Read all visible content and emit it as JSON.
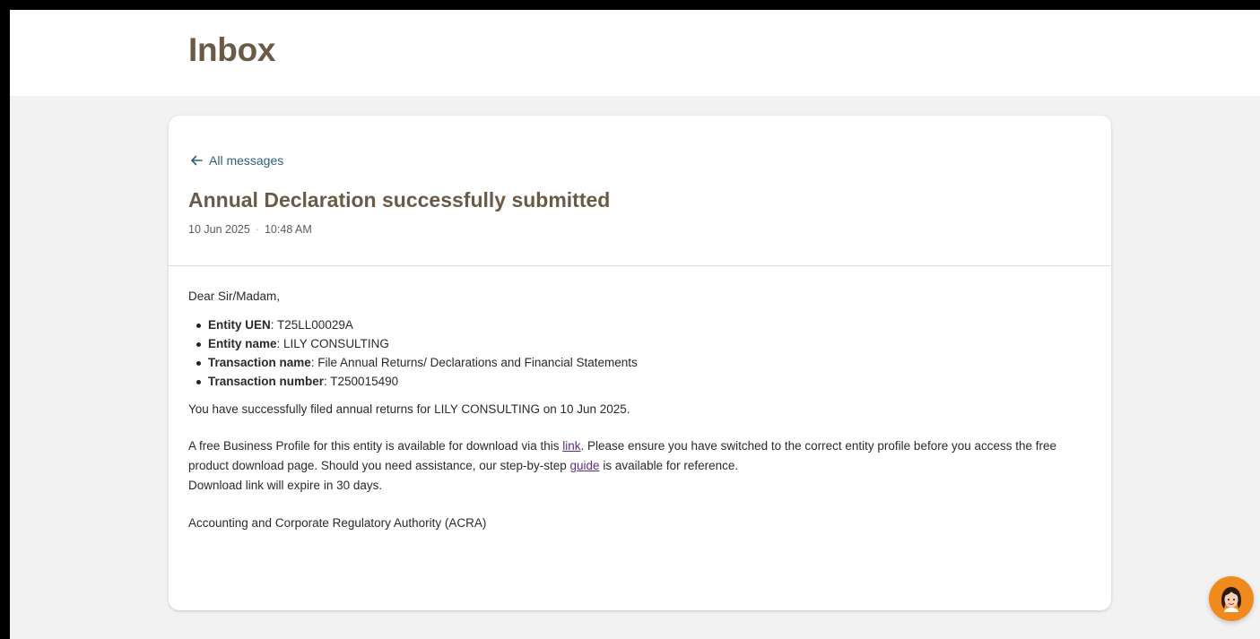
{
  "header": {
    "title": "Inbox"
  },
  "message": {
    "back_label": "All messages",
    "title": "Annual Declaration successfully submitted",
    "date": "10 Jun 2025",
    "time": "10:48 AM",
    "greeting": "Dear Sir/Madam,",
    "details": [
      {
        "label": "Entity UEN",
        "value": ": T25LL00029A"
      },
      {
        "label": "Entity name",
        "value": ": LILY CONSULTING"
      },
      {
        "label": "Transaction name",
        "value": ": File Annual Returns/ Declarations and Financial Statements"
      },
      {
        "label": "Transaction number",
        "value": ": T250015490"
      }
    ],
    "filed_text": "You have successfully filed annual returns for LILY CONSULTING on 10 Jun 2025.",
    "profile_text_1": "A free Business Profile for this entity is available for download via this ",
    "profile_link": "link",
    "profile_text_2": ". Please ensure you have switched to the correct entity profile before you access the free product download page. Should you need assistance, our step-by-step ",
    "guide_link": "guide",
    "profile_text_3": " is available for reference.",
    "expiry_text": "Download link will expire in 30 days.",
    "signature": "Accounting and Corporate Regulatory Authority (ACRA)"
  },
  "chat": {
    "icon": "assistant-avatar-icon",
    "color": "#f08a1c"
  },
  "colors": {
    "title": "#6b5a47",
    "back_link": "#2d5f78",
    "link": "#5a2d82",
    "background": "#f2f2f2"
  }
}
